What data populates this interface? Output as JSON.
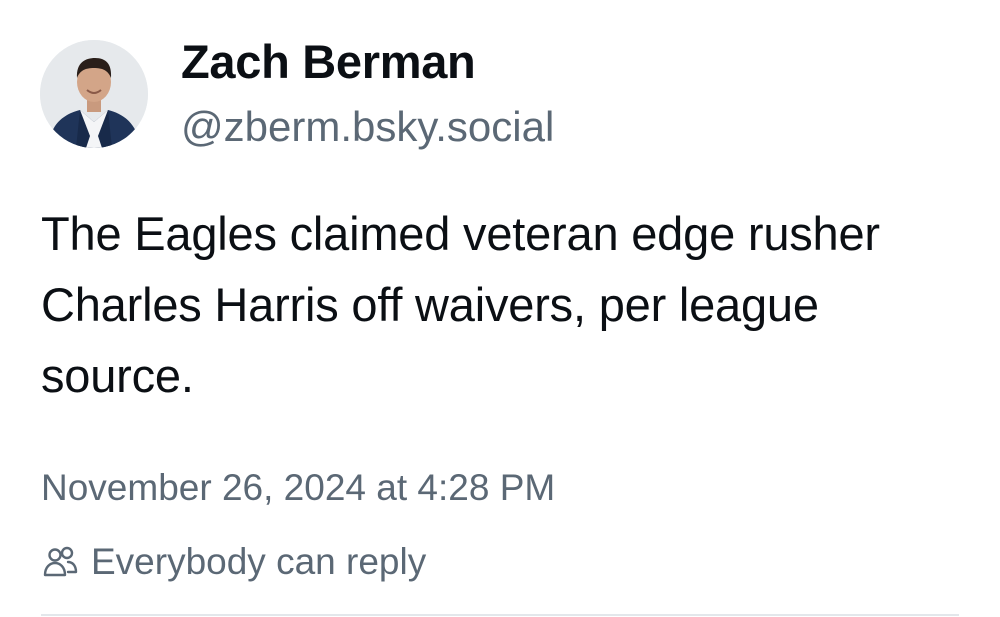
{
  "author": {
    "display_name": "Zach Berman",
    "handle": "@zberm.bsky.social",
    "avatar_icon": "profile-photo"
  },
  "post": {
    "text": "The Eagles claimed veteran edge rusher Charles Harris off waivers, per league source.",
    "timestamp": "November 26, 2024 at 4:28 PM"
  },
  "reply_setting": {
    "icon": "people-icon",
    "label": "Everybody can reply"
  },
  "colors": {
    "text_primary": "#0b0f14",
    "text_secondary": "#5b6875",
    "divider": "#e3e7eb"
  }
}
